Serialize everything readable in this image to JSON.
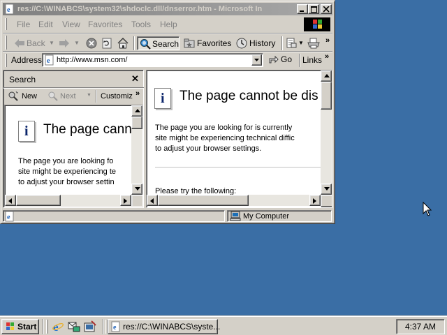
{
  "window": {
    "title": "res://C:\\WINABCS\\system32\\shdoclc.dll/dnserror.htm - Microsoft In"
  },
  "menubar": {
    "items": [
      "File",
      "Edit",
      "View",
      "Favorites",
      "Tools",
      "Help"
    ]
  },
  "toolbar": {
    "back_label": "Back",
    "search_label": "Search",
    "favorites_label": "Favorites",
    "history_label": "History"
  },
  "addressbar": {
    "label": "Address",
    "value": "http://www.msn.com/",
    "go_label": "Go",
    "links_label": "Links"
  },
  "search_pane": {
    "title": "Search",
    "new_label": "New",
    "next_label": "Next",
    "customize_label": "Customiz",
    "error_title": "The page cann",
    "body_lines": [
      "The page you are looking fo",
      "site might be experiencing te",
      "to adjust your browser settin"
    ]
  },
  "main_content": {
    "error_title": "The page cannot be dis",
    "body_lines": [
      "The page you are looking for is currently",
      "site might be experiencing technical diffic",
      "to adjust your browser settings."
    ],
    "try_text": "Please try the following:"
  },
  "statusbar": {
    "zone_label": "My Computer"
  },
  "taskbar": {
    "start_label": "Start",
    "task_label": "res://C:\\WINABCS\\syste...",
    "clock": "4:37 AM"
  }
}
